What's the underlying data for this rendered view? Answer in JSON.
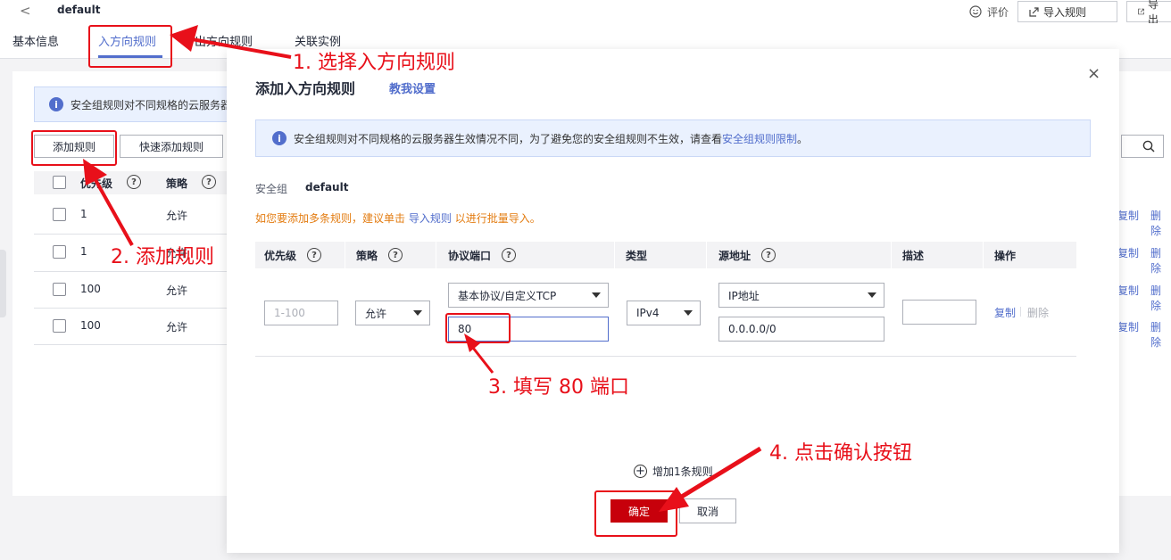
{
  "page": {
    "back_glyph": "<",
    "name": "default",
    "evaluate_label": "评价",
    "import_button": "导入规则",
    "export_button": "导出",
    "tabs": [
      "基本信息",
      "入方向规则",
      "出方向规则",
      "关联实例"
    ]
  },
  "background": {
    "info_text": "安全组规则对不同规格的云服务器",
    "add_rule_button": "添加规则",
    "quick_add_button": "快速添加规则",
    "table_headers": {
      "priority": "优先级",
      "policy": "策略"
    },
    "rows": [
      {
        "priority": "1",
        "policy": "允许"
      },
      {
        "priority": "1",
        "policy": "允许"
      },
      {
        "priority": "100",
        "policy": "允许"
      },
      {
        "priority": "100",
        "policy": "允许"
      }
    ],
    "copy_link": "复制",
    "delete_link": "删除"
  },
  "modal": {
    "title": "添加入方向规则",
    "tutorial_link": "教我设置",
    "close_glyph": "×",
    "info_prefix": "安全组规则对不同规格的云服务器生效情况不同，为了避免您的安全组规则不生效，请查看",
    "info_link": "安全组规则限制",
    "info_suffix": "。",
    "sg_label": "安全组",
    "sg_value": "default",
    "hint_prefix": "如您要添加多条规则，建议单击",
    "hint_link": "导入规则",
    "hint_suffix": "以进行批量导入。",
    "columns": {
      "priority": "优先级",
      "policy": "策略",
      "protocol_port": "协议端口",
      "type": "类型",
      "source": "源地址",
      "description": "描述",
      "action": "操作"
    },
    "row": {
      "priority_placeholder": "1-100",
      "policy_value": "允许",
      "protocol_value": "基本协议/自定义TCP",
      "port_value": "80",
      "type_value": "IPv4",
      "source_type_value": "IP地址",
      "source_ip_value": "0.0.0.0/0",
      "description_value": "",
      "copy_label": "复制",
      "delete_label": "删除"
    },
    "add_row_label": "增加1条规则",
    "confirm_button": "确定",
    "cancel_button": "取消"
  },
  "annotations": {
    "step1": "1. 选择入方向规则",
    "step2": "2. 添加规则",
    "step3": "3. 填写 80 端口",
    "step4": "4. 点击确认按钮",
    "highlight_color": "#e8101a"
  },
  "colors": {
    "accent": "#526ecc",
    "confirm": "#c7000b",
    "hint": "#e37c11"
  }
}
